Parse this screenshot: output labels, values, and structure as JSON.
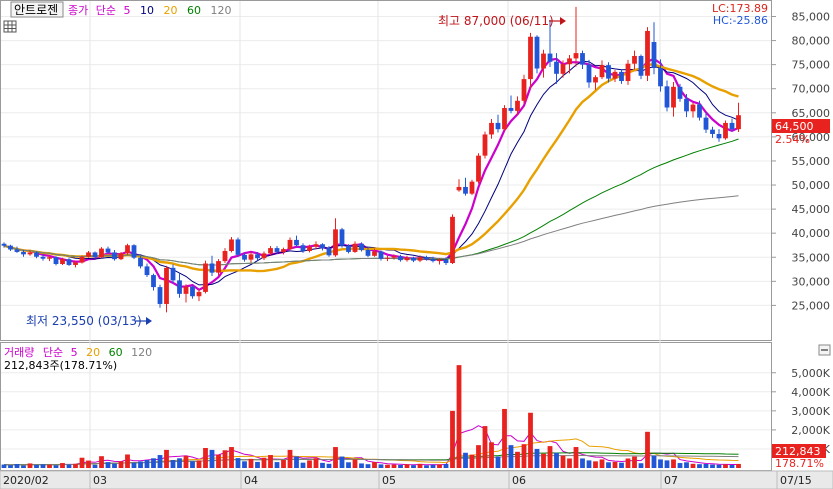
{
  "price_panel": {
    "stock_name": "안트로젠",
    "legend": {
      "close_label": "종가",
      "ma_label": "단순",
      "periods": [
        "5",
        "10",
        "20",
        "60",
        "120"
      ],
      "colors": [
        "#cc00cc",
        "#000080",
        "#e8a000",
        "#008000",
        "#808080"
      ]
    },
    "lc": "LC:173.89",
    "hc": "HC:-25.86",
    "high_annotation": "최고 87,000 (06/11)",
    "low_annotation": "최저 23,550 (03/13)",
    "last_price": "64,500",
    "change_pct": "2.54%"
  },
  "volume_panel": {
    "title": "거래량",
    "ma_label": "단순",
    "periods": [
      "5",
      "20",
      "60",
      "120"
    ],
    "volume_text": "212,843주(178.71%)",
    "last_volume": "212,843",
    "last_pct": "178.71%"
  },
  "x_labels": [
    "2020/02",
    "03",
    "04",
    "05",
    "06",
    "07",
    "07/15"
  ],
  "colors": {
    "up": "#e8231f",
    "down": "#2157d6",
    "ma5": "#cc00cc",
    "ma10": "#000080",
    "ma20": "#e8a000",
    "ma60": "#008000",
    "ma120": "#808080"
  },
  "chart_data": {
    "type": "candlestick",
    "price_axis": {
      "ticks": [
        25000,
        30000,
        35000,
        40000,
        45000,
        50000,
        55000,
        60000,
        65000,
        70000,
        75000,
        80000,
        85000
      ],
      "tick_labels": [
        "25,000",
        "30,000",
        "35,000",
        "40,000",
        "45,000",
        "50,000",
        "55,000",
        "60,000",
        "65,000",
        "70,000",
        "75,000",
        "80,000",
        "85,000"
      ]
    },
    "volume_axis": {
      "ticks": [
        1000000,
        2000000,
        3000000,
        4000000,
        5000000
      ],
      "tick_labels": [
        "1,000K",
        "2,000K",
        "3,000K",
        "4,000K",
        "5,000K"
      ]
    },
    "ohlc": [
      [
        37800,
        38100,
        37000,
        37400
      ],
      [
        37400,
        37600,
        36300,
        36600
      ],
      [
        36600,
        37200,
        35900,
        36100
      ],
      [
        36100,
        36500,
        35100,
        35600
      ],
      [
        35600,
        36400,
        35300,
        36000
      ],
      [
        36000,
        36200,
        34800,
        35100
      ],
      [
        35100,
        35600,
        34300,
        34700
      ],
      [
        34700,
        35300,
        34200,
        35000
      ],
      [
        35000,
        35200,
        33300,
        33600
      ],
      [
        33600,
        34900,
        33400,
        34600
      ],
      [
        34600,
        34800,
        33200,
        33400
      ],
      [
        33400,
        34300,
        32900,
        33900
      ],
      [
        33900,
        35400,
        33700,
        35100
      ],
      [
        35100,
        36300,
        34900,
        36000
      ],
      [
        36000,
        36200,
        34700,
        35000
      ],
      [
        35000,
        37100,
        34800,
        36800
      ],
      [
        36800,
        37200,
        35700,
        36000
      ],
      [
        36000,
        36500,
        34300,
        34600
      ],
      [
        34600,
        36100,
        34400,
        35800
      ],
      [
        35800,
        37800,
        35500,
        37500
      ],
      [
        37500,
        37700,
        34600,
        34900
      ],
      [
        34900,
        35200,
        32700,
        33100
      ],
      [
        33100,
        33700,
        30900,
        31300
      ],
      [
        31300,
        31600,
        28100,
        28800
      ],
      [
        28800,
        29300,
        24500,
        25300
      ],
      [
        25300,
        33200,
        23550,
        32800
      ],
      [
        32800,
        33500,
        29600,
        30200
      ],
      [
        30200,
        31700,
        26600,
        27400
      ],
      [
        27400,
        29400,
        25600,
        28900
      ],
      [
        28900,
        29100,
        26400,
        26900
      ],
      [
        26900,
        28300,
        25900,
        27800
      ],
      [
        27800,
        34300,
        27500,
        33700
      ],
      [
        33700,
        35300,
        31100,
        31800
      ],
      [
        31800,
        34600,
        31200,
        34200
      ],
      [
        34200,
        36900,
        33800,
        36300
      ],
      [
        36300,
        39200,
        36000,
        38700
      ],
      [
        38700,
        39100,
        35100,
        35500
      ],
      [
        35500,
        35900,
        34100,
        34500
      ],
      [
        34500,
        36100,
        33900,
        35600
      ],
      [
        35600,
        36100,
        34300,
        34800
      ],
      [
        34800,
        36200,
        34400,
        35800
      ],
      [
        35800,
        37300,
        35400,
        36900
      ],
      [
        36900,
        37300,
        35700,
        36100
      ],
      [
        36100,
        37000,
        35600,
        36700
      ],
      [
        36700,
        39100,
        36500,
        38600
      ],
      [
        38600,
        39500,
        37100,
        37500
      ],
      [
        37500,
        37900,
        35900,
        36300
      ],
      [
        36300,
        37600,
        36000,
        37200
      ],
      [
        37200,
        38300,
        36700,
        37700
      ],
      [
        37700,
        37900,
        36400,
        36900
      ],
      [
        36900,
        37300,
        35100,
        35400
      ],
      [
        35400,
        43100,
        35100,
        40800
      ],
      [
        40800,
        41100,
        37000,
        37400
      ],
      [
        37400,
        37700,
        35800,
        36100
      ],
      [
        36100,
        38300,
        35900,
        37800
      ],
      [
        37800,
        38100,
        36200,
        36500
      ],
      [
        36500,
        36900,
        35000,
        35300
      ],
      [
        35300,
        36800,
        35100,
        36200
      ],
      [
        36200,
        36400,
        34300,
        34700
      ],
      [
        34700,
        35300,
        34200,
        34900
      ],
      [
        34900,
        35600,
        34500,
        35200
      ],
      [
        35200,
        35500,
        34100,
        34400
      ],
      [
        34400,
        35300,
        34100,
        34900
      ],
      [
        34900,
        35100,
        34000,
        34300
      ],
      [
        34300,
        35400,
        34000,
        35000
      ],
      [
        35000,
        35300,
        34300,
        34600
      ],
      [
        34600,
        35100,
        33900,
        34200
      ],
      [
        34200,
        34800,
        33500,
        34500
      ],
      [
        34500,
        35000,
        33400,
        33800
      ],
      [
        33800,
        43900,
        33600,
        43400
      ],
      [
        48900,
        51200,
        48600,
        49600
      ],
      [
        49600,
        51500,
        47800,
        48200
      ],
      [
        48200,
        51100,
        47900,
        50700
      ],
      [
        50700,
        56600,
        50300,
        56100
      ],
      [
        56100,
        61100,
        55500,
        60500
      ],
      [
        60500,
        63700,
        59600,
        62900
      ],
      [
        62900,
        64600,
        60900,
        61600
      ],
      [
        61600,
        66600,
        61300,
        66000
      ],
      [
        66000,
        68600,
        64900,
        65400
      ],
      [
        65400,
        68400,
        64600,
        67500
      ],
      [
        67500,
        72900,
        66900,
        72000
      ],
      [
        72000,
        81600,
        70000,
        80800
      ],
      [
        80800,
        81100,
        73200,
        74200
      ],
      [
        74200,
        78100,
        72300,
        77300
      ],
      [
        77300,
        84300,
        74500,
        75600
      ],
      [
        75600,
        77400,
        71000,
        73100
      ],
      [
        73100,
        75900,
        72300,
        75100
      ],
      [
        75100,
        77000,
        73200,
        76300
      ],
      [
        76300,
        87000,
        74600,
        77400
      ],
      [
        77400,
        77900,
        74100,
        75000
      ],
      [
        75000,
        76000,
        70200,
        71300
      ],
      [
        71300,
        72800,
        69800,
        72400
      ],
      [
        72400,
        75900,
        72000,
        74900
      ],
      [
        74900,
        75500,
        71300,
        72100
      ],
      [
        72100,
        73900,
        71400,
        73500
      ],
      [
        73500,
        74100,
        71000,
        71600
      ],
      [
        71600,
        76000,
        70800,
        75200
      ],
      [
        75200,
        77900,
        74000,
        76800
      ],
      [
        76800,
        77100,
        72000,
        72700
      ],
      [
        72700,
        82800,
        71600,
        82000
      ],
      [
        79700,
        83800,
        73000,
        74300
      ],
      [
        74300,
        76100,
        69400,
        70500
      ],
      [
        70500,
        71700,
        65300,
        66100
      ],
      [
        66100,
        71400,
        64200,
        70400
      ],
      [
        70400,
        71000,
        67300,
        67900
      ],
      [
        67900,
        68900,
        64100,
        65300
      ],
      [
        65300,
        67100,
        64000,
        66700
      ],
      [
        66700,
        67500,
        63400,
        64000
      ],
      [
        64000,
        65100,
        60800,
        61500
      ],
      [
        61500,
        62100,
        59800,
        60600
      ],
      [
        60600,
        61600,
        59000,
        59700
      ],
      [
        59700,
        63400,
        59400,
        62900
      ],
      [
        62900,
        63800,
        61100,
        61600
      ],
      [
        61600,
        67100,
        61000,
        64500
      ]
    ],
    "volume": [
      [
        180000,
        "d"
      ],
      [
        150000,
        "d"
      ],
      [
        210000,
        "d"
      ],
      [
        130000,
        "d"
      ],
      [
        240000,
        "u"
      ],
      [
        160000,
        "d"
      ],
      [
        190000,
        "d"
      ],
      [
        170000,
        "u"
      ],
      [
        140000,
        "d"
      ],
      [
        260000,
        "u"
      ],
      [
        180000,
        "d"
      ],
      [
        220000,
        "u"
      ],
      [
        540000,
        "u"
      ],
      [
        390000,
        "u"
      ],
      [
        170000,
        "d"
      ],
      [
        620000,
        "u"
      ],
      [
        310000,
        "d"
      ],
      [
        230000,
        "d"
      ],
      [
        350000,
        "u"
      ],
      [
        710000,
        "u"
      ],
      [
        280000,
        "d"
      ],
      [
        340000,
        "d"
      ],
      [
        420000,
        "d"
      ],
      [
        510000,
        "d"
      ],
      [
        680000,
        "d"
      ],
      [
        950000,
        "u"
      ],
      [
        420000,
        "d"
      ],
      [
        510000,
        "d"
      ],
      [
        640000,
        "u"
      ],
      [
        350000,
        "d"
      ],
      [
        400000,
        "u"
      ],
      [
        1050000,
        "u"
      ],
      [
        950000,
        "d"
      ],
      [
        700000,
        "u"
      ],
      [
        930000,
        "u"
      ],
      [
        1100000,
        "u"
      ],
      [
        520000,
        "d"
      ],
      [
        350000,
        "d"
      ],
      [
        480000,
        "u"
      ],
      [
        320000,
        "d"
      ],
      [
        540000,
        "u"
      ],
      [
        680000,
        "u"
      ],
      [
        310000,
        "d"
      ],
      [
        420000,
        "u"
      ],
      [
        950000,
        "u"
      ],
      [
        610000,
        "d"
      ],
      [
        280000,
        "d"
      ],
      [
        400000,
        "u"
      ],
      [
        510000,
        "u"
      ],
      [
        270000,
        "d"
      ],
      [
        220000,
        "d"
      ],
      [
        1100000,
        "u"
      ],
      [
        600000,
        "d"
      ],
      [
        300000,
        "d"
      ],
      [
        450000,
        "u"
      ],
      [
        240000,
        "d"
      ],
      [
        200000,
        "d"
      ],
      [
        310000,
        "u"
      ],
      [
        190000,
        "d"
      ],
      [
        170000,
        "u"
      ],
      [
        180000,
        "u"
      ],
      [
        160000,
        "d"
      ],
      [
        200000,
        "u"
      ],
      [
        150000,
        "d"
      ],
      [
        220000,
        "u"
      ],
      [
        140000,
        "d"
      ],
      [
        170000,
        "d"
      ],
      [
        190000,
        "u"
      ],
      [
        210000,
        "d"
      ],
      [
        3000000,
        "u"
      ],
      [
        5400000,
        "u"
      ],
      [
        800000,
        "d"
      ],
      [
        700000,
        "u"
      ],
      [
        1200000,
        "u"
      ],
      [
        2200000,
        "u"
      ],
      [
        1350000,
        "u"
      ],
      [
        600000,
        "d"
      ],
      [
        3100000,
        "u"
      ],
      [
        1200000,
        "d"
      ],
      [
        850000,
        "u"
      ],
      [
        1250000,
        "u"
      ],
      [
        2900000,
        "u"
      ],
      [
        1000000,
        "d"
      ],
      [
        750000,
        "u"
      ],
      [
        1150000,
        "u"
      ],
      [
        800000,
        "d"
      ],
      [
        650000,
        "u"
      ],
      [
        500000,
        "u"
      ],
      [
        1100000,
        "u"
      ],
      [
        500000,
        "d"
      ],
      [
        400000,
        "d"
      ],
      [
        350000,
        "u"
      ],
      [
        450000,
        "u"
      ],
      [
        300000,
        "d"
      ],
      [
        320000,
        "u"
      ],
      [
        280000,
        "d"
      ],
      [
        500000,
        "u"
      ],
      [
        600000,
        "u"
      ],
      [
        250000,
        "d"
      ],
      [
        1900000,
        "u"
      ],
      [
        650000,
        "d"
      ],
      [
        450000,
        "d"
      ],
      [
        400000,
        "d"
      ],
      [
        450000,
        "u"
      ],
      [
        260000,
        "d"
      ],
      [
        300000,
        "d"
      ],
      [
        220000,
        "u"
      ],
      [
        200000,
        "d"
      ],
      [
        210000,
        "d"
      ],
      [
        180000,
        "d"
      ],
      [
        170000,
        "d"
      ],
      [
        190000,
        "u"
      ],
      [
        160000,
        "d"
      ],
      [
        212843,
        "u"
      ]
    ]
  }
}
